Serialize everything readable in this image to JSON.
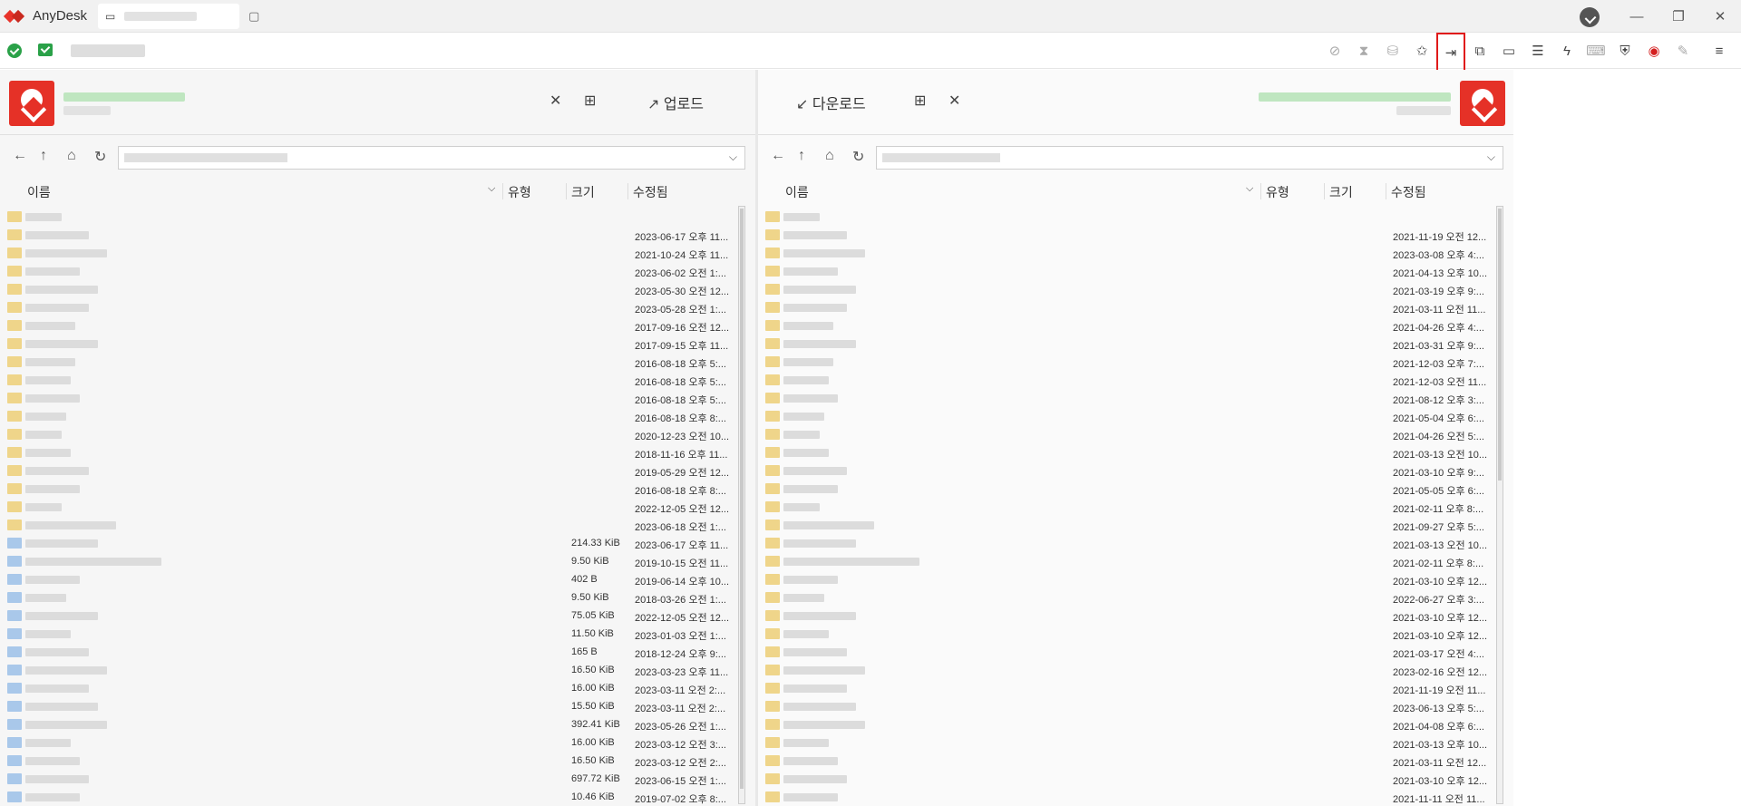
{
  "app": {
    "name": "AnyDesk"
  },
  "window": {
    "minimize": "—",
    "restore": "❐",
    "close": "✕"
  },
  "toolbar": {
    "icons": [
      "monitor-off-icon",
      "hourglass-icon",
      "database-icon",
      "star-icon",
      "file-transfer-icon",
      "screenshot-icon",
      "display-icon",
      "chat-icon",
      "action-icon",
      "keyboard-icon",
      "permissions-icon",
      "record-icon",
      "whiteboard-icon",
      "menu-icon"
    ]
  },
  "left": {
    "upload_label": "업로드",
    "columns": {
      "name": "이름",
      "type": "유형",
      "size": "크기",
      "modified": "수정됨"
    },
    "rows": [
      {
        "size": "",
        "date": ""
      },
      {
        "size": "",
        "date": "2023-06-17 오후 11..."
      },
      {
        "size": "",
        "date": "2021-10-24 오후 11..."
      },
      {
        "size": "",
        "date": "2023-06-02 오전 1:..."
      },
      {
        "size": "",
        "date": "2023-05-30 오전 12..."
      },
      {
        "size": "",
        "date": "2023-05-28 오전 1:..."
      },
      {
        "size": "",
        "date": "2017-09-16 오전 12..."
      },
      {
        "size": "",
        "date": "2017-09-15 오후 11..."
      },
      {
        "size": "",
        "date": "2016-08-18 오후 5:..."
      },
      {
        "size": "",
        "date": "2016-08-18 오후 5:..."
      },
      {
        "size": "",
        "date": "2016-08-18 오후 5:..."
      },
      {
        "size": "",
        "date": "2016-08-18 오후 8:..."
      },
      {
        "size": "",
        "date": "2020-12-23 오전 10..."
      },
      {
        "size": "",
        "date": "2018-11-16 오후 11..."
      },
      {
        "size": "",
        "date": "2019-05-29 오전 12..."
      },
      {
        "size": "",
        "date": "2016-08-18 오후 8:..."
      },
      {
        "size": "",
        "date": "2022-12-05 오전 12..."
      },
      {
        "size": "",
        "date": "2023-06-18 오전 1:..."
      },
      {
        "size": "214.33 KiB",
        "date": "2023-06-17 오후 11..."
      },
      {
        "size": "9.50 KiB",
        "date": "2019-10-15 오전 11..."
      },
      {
        "size": "402 B",
        "date": "2019-06-14 오후 10..."
      },
      {
        "size": "9.50 KiB",
        "date": "2018-03-26 오전 1:..."
      },
      {
        "size": "75.05 KiB",
        "date": "2022-12-05 오전 12..."
      },
      {
        "size": "11.50 KiB",
        "date": "2023-01-03 오전 1:..."
      },
      {
        "size": "165 B",
        "date": "2018-12-24 오후 9:..."
      },
      {
        "size": "16.50 KiB",
        "date": "2023-03-23 오후 11..."
      },
      {
        "size": "16.00 KiB",
        "date": "2023-03-11 오전 2:..."
      },
      {
        "size": "15.50 KiB",
        "date": "2023-03-11 오전 2:..."
      },
      {
        "size": "392.41 KiB",
        "date": "2023-05-26 오전 1:..."
      },
      {
        "size": "16.00 KiB",
        "date": "2023-03-12 오전 3:..."
      },
      {
        "size": "16.50 KiB",
        "date": "2023-03-12 오전 2:..."
      },
      {
        "size": "697.72 KiB",
        "date": "2023-06-15 오전 1:..."
      },
      {
        "size": "10.46 KiB",
        "date": "2019-07-02 오후 8:..."
      }
    ]
  },
  "right": {
    "download_label": "다운로드",
    "columns": {
      "name": "이름",
      "type": "유형",
      "size": "크기",
      "modified": "수정됨"
    },
    "rows": [
      {
        "date": ""
      },
      {
        "date": "2021-11-19 오전 12..."
      },
      {
        "date": "2023-03-08 오후 4:..."
      },
      {
        "date": "2021-04-13 오후 10..."
      },
      {
        "date": "2021-03-19 오후 9:..."
      },
      {
        "date": "2021-03-11 오전 11..."
      },
      {
        "date": "2021-04-26 오후 4:..."
      },
      {
        "date": "2021-03-31 오후 9:..."
      },
      {
        "date": "2021-12-03 오후 7:..."
      },
      {
        "date": "2021-12-03 오전 11..."
      },
      {
        "date": "2021-08-12 오후 3:..."
      },
      {
        "date": "2021-05-04 오후 6:..."
      },
      {
        "date": "2021-04-26 오전 5:..."
      },
      {
        "date": "2021-03-13 오전 10..."
      },
      {
        "date": "2021-03-10 오후 9:..."
      },
      {
        "date": "2021-05-05 오후 6:..."
      },
      {
        "date": "2021-02-11 오후 8:..."
      },
      {
        "date": "2021-09-27 오후 5:..."
      },
      {
        "date": "2021-03-13 오전 10..."
      },
      {
        "date": "2021-02-11 오후 8:..."
      },
      {
        "date": "2021-03-10 오후 12..."
      },
      {
        "date": "2022-06-27 오후 3:..."
      },
      {
        "date": "2021-03-10 오후 12..."
      },
      {
        "date": "2021-03-10 오후 12..."
      },
      {
        "date": "2021-03-17 오전 4:..."
      },
      {
        "date": "2023-02-16 오전 12..."
      },
      {
        "date": "2021-11-19 오전 11..."
      },
      {
        "date": "2023-06-13 오후 5:..."
      },
      {
        "date": "2021-04-08 오후 6:..."
      },
      {
        "date": "2021-03-13 오후 10..."
      },
      {
        "date": "2021-03-11 오전 12..."
      },
      {
        "date": "2021-03-10 오후 12..."
      },
      {
        "date": "2021-11-11 오전 11..."
      }
    ]
  },
  "colors": {
    "brand": "#e53127",
    "ok": "#2aa148",
    "highlight": "#e01a1a"
  }
}
